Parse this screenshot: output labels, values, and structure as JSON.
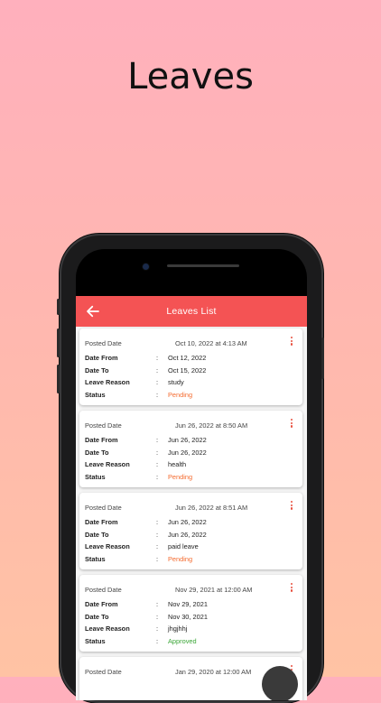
{
  "promo": {
    "title": "Leaves"
  },
  "appbar": {
    "title": "Leaves List"
  },
  "labels": {
    "posted_date": "Posted Date",
    "date_from": "Date From",
    "date_to": "Date To",
    "leave_reason": "Leave Reason",
    "status": "Status",
    "colon": ":"
  },
  "colors": {
    "accent": "#f45354",
    "pending": "#f46a2e",
    "approved": "#3aa637",
    "kebab": "#e8503f"
  },
  "leaves": [
    {
      "posted": "Oct 10, 2022 at 4:13 AM",
      "from": "Oct 12, 2022",
      "to": "Oct 15, 2022",
      "reason": "study",
      "status": "Pending"
    },
    {
      "posted": "Jun 26, 2022 at 8:50 AM",
      "from": "Jun 26, 2022",
      "to": "Jun 26, 2022",
      "reason": "health",
      "status": "Pending"
    },
    {
      "posted": "Jun 26, 2022 at 8:51 AM",
      "from": "Jun 26, 2022",
      "to": "Jun 26, 2022",
      "reason": "paid leave",
      "status": "Pending"
    },
    {
      "posted": "Nov 29, 2021 at 12:00 AM",
      "from": "Nov 29, 2021",
      "to": "Nov 30, 2021",
      "reason": "jhgjhhj",
      "status": "Approved"
    },
    {
      "posted": "Jan 29, 2020 at 12:00 AM"
    }
  ],
  "icons": {
    "back": "arrow-left-icon",
    "menu": "more-vertical-icon"
  }
}
